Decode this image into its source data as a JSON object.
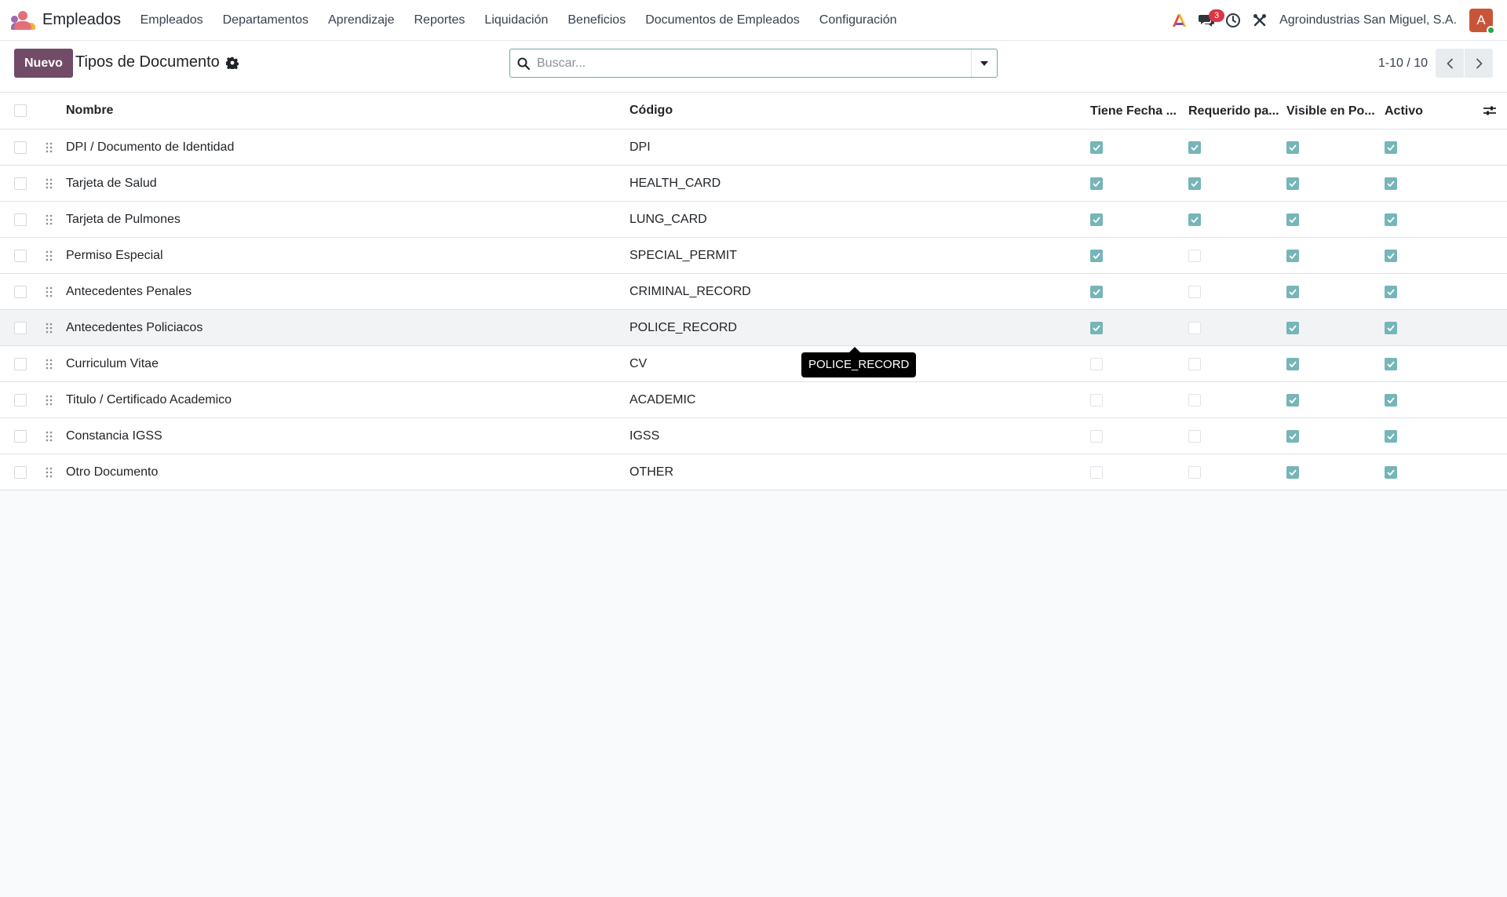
{
  "app": {
    "name": "Empleados",
    "icon": "employees-app-icon"
  },
  "menu": [
    "Empleados",
    "Departamentos",
    "Aprendizaje",
    "Reportes",
    "Liquidación",
    "Beneficios",
    "Documentos de Empleados",
    "Configuración"
  ],
  "systray": {
    "messages_badge": "3",
    "company": "Agroindustrias San Miguel, S.A.",
    "avatar_letter": "A"
  },
  "control": {
    "new_label": "Nuevo",
    "title": "Tipos de Documento",
    "search_placeholder": "Buscar...",
    "pager": "1-10 / 10"
  },
  "list": {
    "columns": {
      "name": "Nombre",
      "code": "Código",
      "has_expiry": "Tiene Fecha ...",
      "required": "Requerido pa...",
      "visible": "Visible en Po...",
      "active": "Activo"
    },
    "rows": [
      {
        "name": "DPI / Documento de Identidad",
        "code": "DPI",
        "has_expiry": true,
        "required": true,
        "visible": true,
        "active": true
      },
      {
        "name": "Tarjeta de Salud",
        "code": "HEALTH_CARD",
        "has_expiry": true,
        "required": true,
        "visible": true,
        "active": true
      },
      {
        "name": "Tarjeta de Pulmones",
        "code": "LUNG_CARD",
        "has_expiry": true,
        "required": true,
        "visible": true,
        "active": true
      },
      {
        "name": "Permiso Especial",
        "code": "SPECIAL_PERMIT",
        "has_expiry": true,
        "required": false,
        "visible": true,
        "active": true
      },
      {
        "name": "Antecedentes Penales",
        "code": "CRIMINAL_RECORD",
        "has_expiry": true,
        "required": false,
        "visible": true,
        "active": true
      },
      {
        "name": "Antecedentes Policiacos",
        "code": "POLICE_RECORD",
        "has_expiry": true,
        "required": false,
        "visible": true,
        "active": true
      },
      {
        "name": "Curriculum Vitae",
        "code": "CV",
        "has_expiry": false,
        "required": false,
        "visible": true,
        "active": true
      },
      {
        "name": "Titulo / Certificado Academico",
        "code": "ACADEMIC",
        "has_expiry": false,
        "required": false,
        "visible": true,
        "active": true
      },
      {
        "name": "Constancia IGSS",
        "code": "IGSS",
        "has_expiry": false,
        "required": false,
        "visible": true,
        "active": true
      },
      {
        "name": "Otro Documento",
        "code": "OTHER",
        "has_expiry": false,
        "required": false,
        "visible": true,
        "active": true
      }
    ]
  },
  "tooltip": {
    "text": "POLICE_RECORD"
  },
  "colors": {
    "primary": "#714b67",
    "checkbox": "#76b5b8",
    "badge": "#dc3545"
  }
}
